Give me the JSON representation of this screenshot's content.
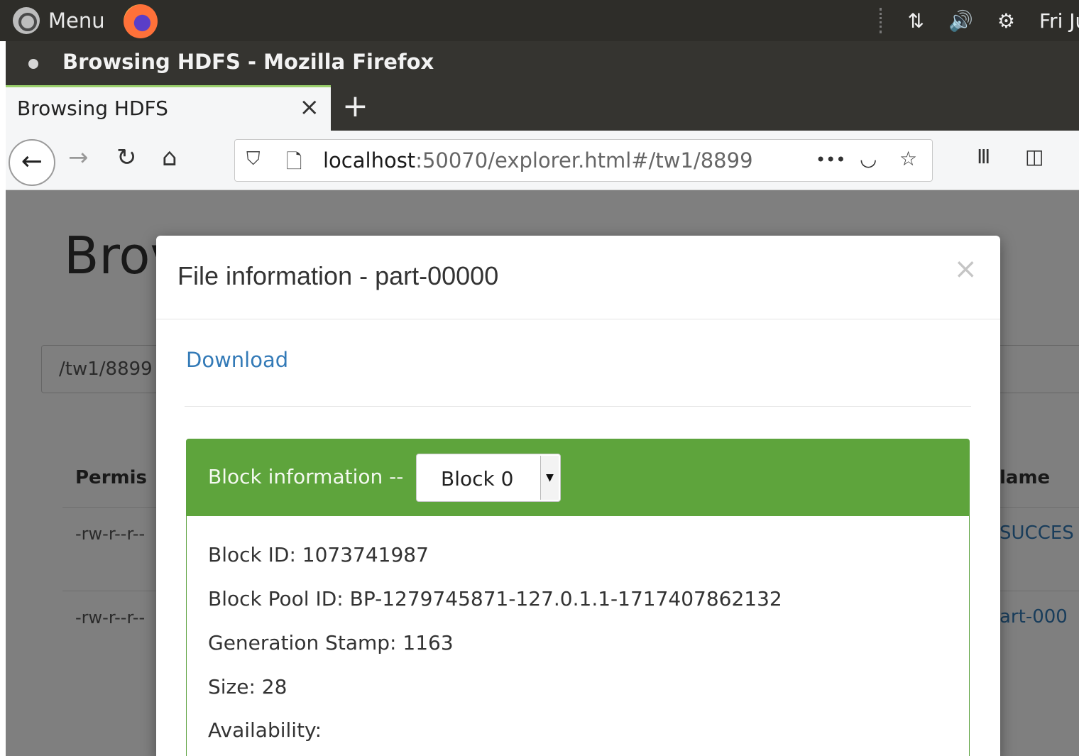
{
  "topbar": {
    "menu_label": "Menu",
    "clock": "Fri Jun"
  },
  "window": {
    "title": "Browsing HDFS - Mozilla Firefox"
  },
  "tabs": [
    {
      "label": "Browsing HDFS",
      "close": "×"
    }
  ],
  "newtab_label": "+",
  "urlbar": {
    "host": "localhost",
    "rest": ":50070/explorer.html#/tw1/8899"
  },
  "background_page": {
    "title": "Brov",
    "path": "/tw1/8899",
    "col_permission": "Permis",
    "col_name": "lame",
    "rows": [
      {
        "perm": "-rw-r--r--",
        "name": "SUCCES"
      },
      {
        "perm": "-rw-r--r--",
        "name": "art-000"
      }
    ]
  },
  "modal": {
    "title": "File information - part-00000",
    "close": "×",
    "download_label": "Download",
    "block_panel": {
      "label": "Block information --",
      "selected_block": "Block 0",
      "block_id": "Block ID: 1073741987",
      "pool_id": "Block Pool ID: BP-1279745871-127.0.1.1-1717407862132",
      "generation_stamp": "Generation Stamp: 1163",
      "size": "Size: 28",
      "availability": "Availability:"
    }
  },
  "colors": {
    "panel_green": "#5ea43c",
    "link_blue": "#337ab7",
    "topbar_dark": "#2e2d29"
  }
}
